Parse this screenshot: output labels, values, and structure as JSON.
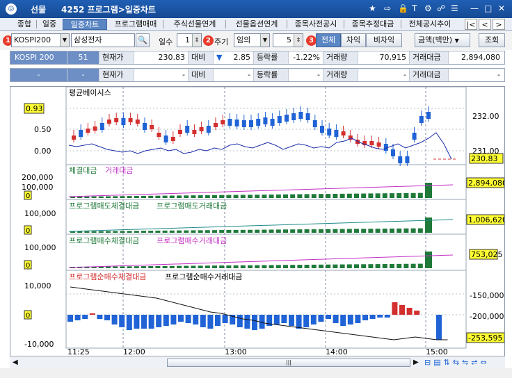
{
  "window": {
    "section": "선물",
    "title": "4252 프로그램>일중차트",
    "icons": [
      "star-icon",
      "export-icon",
      "lock-icon",
      "font-icon",
      "settings-icon",
      "link-icon",
      "list-icon",
      "minimize-icon",
      "maximize-icon",
      "close-icon"
    ]
  },
  "tabs": [
    {
      "label": "종합"
    },
    {
      "label": "일중"
    },
    {
      "label": "일중차트",
      "active": true
    },
    {
      "label": "프로그램매매"
    },
    {
      "label": "주식선물연계"
    },
    {
      "label": "선물옵션연계"
    },
    {
      "label": "종목사전공시"
    },
    {
      "label": "종목추정대금"
    },
    {
      "label": "전체공시추이"
    }
  ],
  "toolbar": {
    "market": "KOSPI200",
    "stock": "삼성전자",
    "days_label": "일수",
    "days": "1",
    "period_label": "주기",
    "period": "임의",
    "period_n": "5",
    "view": [
      "전체",
      "차익",
      "비차익"
    ],
    "amount": "금액(백만)",
    "query": "조회",
    "badges": [
      "1",
      "2",
      "3"
    ]
  },
  "info": {
    "row1": {
      "name": "KOSPI 200",
      "code": "51",
      "cur_label": "현재가",
      "cur": "230.83",
      "chg_label": "대비",
      "chg": "2.85",
      "rate_label": "등락률",
      "rate": "-1.22%",
      "vol_label": "거래량",
      "vol": "70,915",
      "amt_label": "거래대금",
      "amt": "2,894,080"
    },
    "row2": {
      "name": "-",
      "code": "-",
      "cur_label": "현재가",
      "cur": "-",
      "chg_label": "대비",
      "chg": "-",
      "rate_label": "등락률",
      "rate": "-",
      "vol_label": "거래량",
      "vol": "-",
      "amt_label": "거래대금",
      "amt": "-"
    }
  },
  "panes": {
    "p1": {
      "legend": "평균베이시스",
      "left_ticks": [
        "0.93",
        "0.50",
        "0.00"
      ],
      "right_ticks": [
        "232.00",
        "231.00"
      ],
      "highlight_left": "0.93",
      "highlight_right": "230.83"
    },
    "p2": {
      "legend_a": "체결대금",
      "legend_b": "거래대금",
      "left_ticks": [
        "200,000",
        "100,000",
        "0"
      ],
      "right_ticks": [
        "2,894,080"
      ]
    },
    "p3": {
      "legend_a": "프로그램매도체결대금",
      "legend_b": "프로그램매도거래대금",
      "left_ticks": [
        "100,000",
        "0"
      ],
      "right_ticks": [
        "1,006,620"
      ]
    },
    "p4": {
      "legend_a": "프로그램매수체결대금",
      "legend_b": "프로그램매수거래대금",
      "left_ticks": [
        "100,000",
        "0"
      ],
      "right_ticks": [
        "753,025"
      ]
    },
    "p5": {
      "legend_a": "프로그램순매수체결대금",
      "legend_b": "프로그램순매수거래대금",
      "left_ticks": [
        "10,000",
        "0",
        "-10,000"
      ],
      "right_ticks": [
        "-150,000",
        "-200,000",
        "-253,595"
      ]
    }
  },
  "x_ticks": [
    "11:25",
    "12:00",
    "13:00",
    "14:00",
    "15:00"
  ],
  "colors": {
    "up": "#d32f2f",
    "down": "#1f63d6",
    "bar": "#1f7a3a",
    "magenta": "#c42fc4",
    "highlight": "#ffff33"
  }
}
